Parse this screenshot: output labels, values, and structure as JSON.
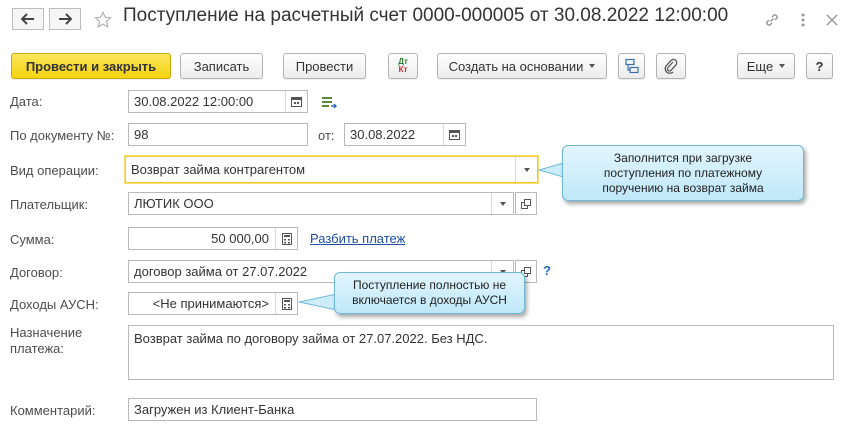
{
  "window": {
    "title": "Поступление на расчетный счет 0000-000005 от 30.08.2022 12:00:00"
  },
  "toolbar": {
    "post_and_close": "Провести и закрыть",
    "save": "Записать",
    "post": "Провести",
    "dt_kt_top": "Дт",
    "dt_kt_bottom": "Кт",
    "create_based_on": "Создать на основании",
    "more": "Еще",
    "help": "?"
  },
  "form": {
    "date": {
      "label": "Дата:",
      "value": "30.08.2022 12:00:00"
    },
    "doc_number": {
      "label": "По документу №:",
      "value": "98"
    },
    "doc_date": {
      "label": "от:",
      "value": "30.08.2022"
    },
    "operation_type": {
      "label": "Вид операции:",
      "value": "Возврат займа контрагентом"
    },
    "payer": {
      "label": "Плательщик:",
      "value": "ЛЮТИК ООО"
    },
    "amount": {
      "label": "Сумма:",
      "value": "50 000,00",
      "split_link": "Разбить платеж"
    },
    "contract": {
      "label": "Договор:",
      "value": "договор займа от 27.07.2022",
      "help": "?"
    },
    "ausn_income": {
      "label": "Доходы АУСН:",
      "value": "<Не принимаются>"
    },
    "purpose": {
      "label_line1": "Назначение",
      "label_line2": "платежа:",
      "value": "Возврат займа по договору займа от 27.07.2022. Без НДС."
    },
    "comment": {
      "label": "Комментарий:",
      "value": "Загружен из Клиент-Банка"
    }
  },
  "callouts": {
    "operation_hint": "Заполнится при загрузке\nпоступления по платежному\nпоручению на возврат займа",
    "ausn_hint": "Поступление полностью не\nвключается в доходы АУСН"
  },
  "colors": {
    "primary_button": "#f5d40f",
    "link": "#1d4fa3",
    "callout_bg": "#bfe8f8",
    "callout_border": "#6fb8d8",
    "focus_border": "#f0c930"
  }
}
